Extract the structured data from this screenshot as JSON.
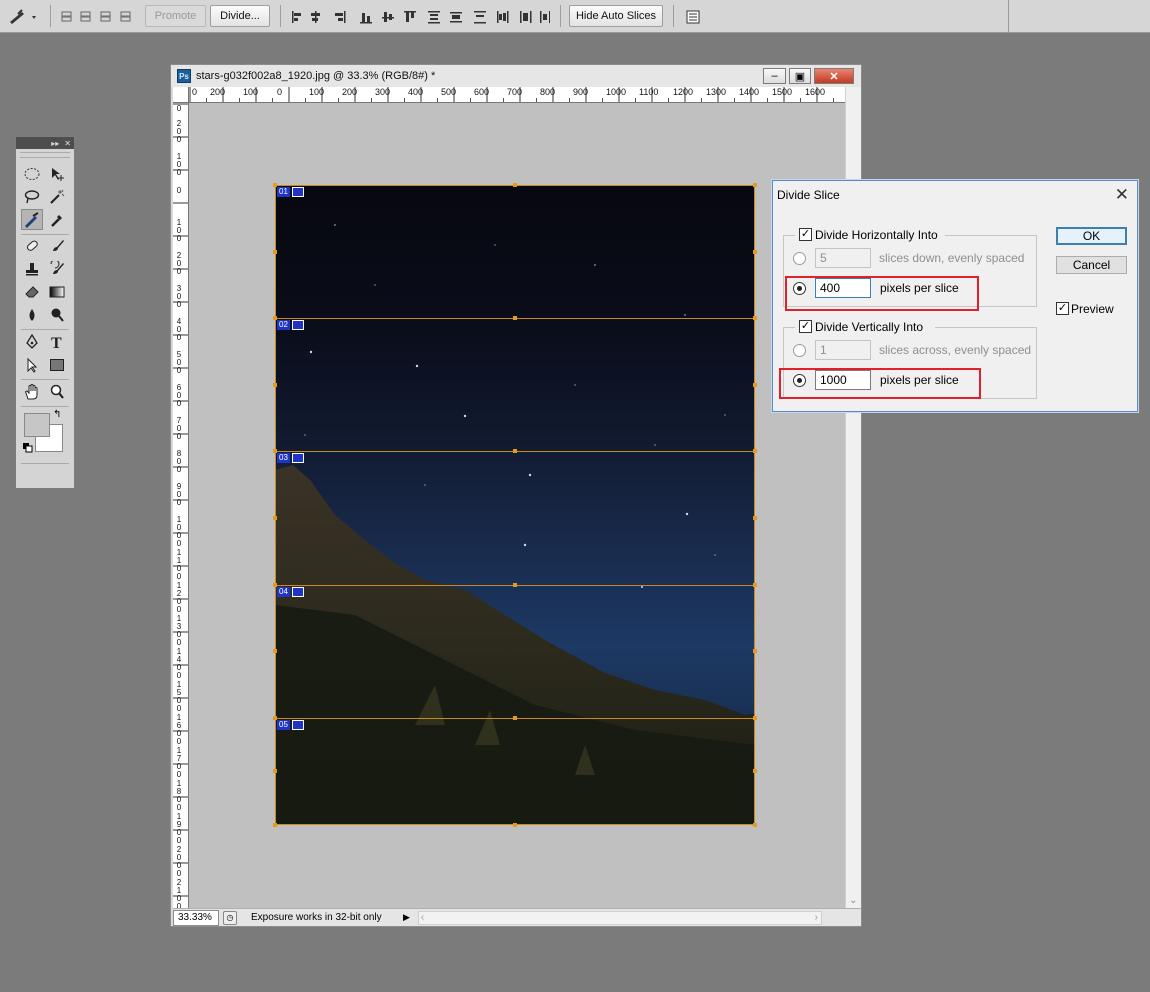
{
  "options_bar": {
    "promote_label": "Promote",
    "divide_label": "Divide...",
    "hide_auto_slices_label": "Hide Auto Slices"
  },
  "document": {
    "title": "stars-g032f002a8_1920.jpg @ 33.3% (RGB/8#) *",
    "app_badge": "Ps",
    "h_ruler_labels": [
      "0",
      "200",
      "100",
      "0",
      "100",
      "200",
      "300",
      "400",
      "500",
      "600",
      "700",
      "800",
      "900",
      "1000",
      "1100",
      "1200",
      "1300",
      "1400",
      "1500",
      "1600"
    ],
    "v_ruler_labels": [
      "0",
      "2 0 0",
      "1 0 0",
      "0",
      "1 0 0",
      "2 0 0",
      "3 0 0",
      "4 0 0",
      "5 0 0",
      "6 0 0",
      "7 0 0",
      "8 0 0",
      "9 0 0",
      "1 0 0 0",
      "1 1 0 0",
      "1 2 0 0",
      "1 3 0 0",
      "1 4 0 0",
      "1 5 0 0",
      "1 6 0 0",
      "1 7 0 0",
      "1 8 0 0",
      "1 9 0 0",
      "2 0 0 0",
      "2 1 0 0",
      "2 2 0 0"
    ],
    "slices": [
      "01",
      "02",
      "03",
      "04",
      "05"
    ],
    "status": {
      "zoom": "33.33%",
      "info": "Exposure works in 32-bit only"
    }
  },
  "dialog": {
    "title": "Divide Slice",
    "horizontal": {
      "label": "Divide Horizontally Into",
      "checked": true,
      "slices_value": "5",
      "slices_label": "slices down, evenly spaced",
      "pixels_value": "400",
      "pixels_label": "pixels per slice"
    },
    "vertical": {
      "label": "Divide Vertically Into",
      "checked": true,
      "slices_value": "1",
      "slices_label": "slices across, evenly spaced",
      "pixels_value": "1000",
      "pixels_label": "pixels per slice"
    },
    "ok_label": "OK",
    "cancel_label": "Cancel",
    "preview_label": "Preview",
    "highlight_color": "#e0202d"
  }
}
